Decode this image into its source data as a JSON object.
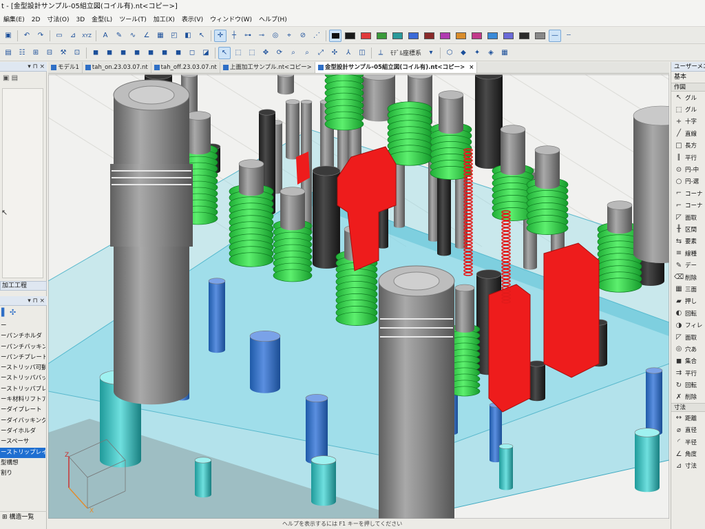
{
  "window": {
    "title": "t - [金型設計サンプル-05組立図(コイル有).nt<コピー>]"
  },
  "menu": [
    "編集(E)",
    "2D",
    "寸法(O)",
    "3D",
    "金型(L)",
    "ツール(T)",
    "加工(X)",
    "表示(V)",
    "ウィンドウ(W)",
    "ヘルプ(H)"
  ],
  "toolbar": {
    "coord_system_label": "ﾓﾃﾞﾙ座標系",
    "xyz_label": "XYZ",
    "colors": [
      "#1a1a1a",
      "#e03a3a",
      "#3a9a3a",
      "#2a9a9a",
      "#3a6ad8",
      "#8a2a2a",
      "#b03ab0",
      "#d98c2a",
      "#c23a8a",
      "#3a8ad8",
      "#6a6ad8",
      "#2a2a2a",
      "#888888"
    ]
  },
  "left_panel": {
    "section_label": "加工工程",
    "tree_items": [
      "ー",
      "ーパンチホルダ",
      "ーパンチバッキング",
      "ーパンチプレート",
      "ーストリッパ可動量",
      "ーストリッパバッキン",
      "ーストリッパプレート",
      "ーキ材料リフトアップ量",
      "ーダイプレート",
      "ーダイバッキング",
      "ーダイホルダ",
      "ースペーサ",
      "ーストリップレイアウト",
      "型構想",
      "割り"
    ],
    "selected_index": 12,
    "status_label": "構造一覧"
  },
  "tabs": [
    {
      "label": "モデル1",
      "active": false
    },
    {
      "label": "tah_on.23.03.07.nt",
      "active": false
    },
    {
      "label": "tah_off.23.03.07.nt",
      "active": false
    },
    {
      "label": "上面加工サンプル.nt<コピー>",
      "active": false
    },
    {
      "label": "金型設計サンプル-05組立図(コイル有).nt<コピー>",
      "active": true
    }
  ],
  "tab_close": "×",
  "viewport": {
    "axis_z": "Z",
    "axis_x": "X",
    "colors": {
      "plate": "#7fd6e8",
      "spring": "#2fd24a",
      "part_red": "#ee1c1c",
      "pin": "#8a8a8a",
      "bolt": "#2b2b2b"
    }
  },
  "status_bar": "ヘルプを表示するには F1 キーを押してください",
  "right_panel": {
    "title": "ユーザーメニュー",
    "subtitle": "基本",
    "section_create": "作図",
    "create_items": [
      {
        "label": "グル",
        "icon": "arrow-icon"
      },
      {
        "label": "グル",
        "icon": "group-icon"
      },
      {
        "label": "十字",
        "icon": "cross-icon"
      },
      {
        "label": "直線",
        "icon": "line-icon"
      },
      {
        "label": "長方",
        "icon": "rect-icon"
      },
      {
        "label": "平行",
        "icon": "parallel-icon"
      },
      {
        "label": "円-中",
        "icon": "circle-center-icon"
      },
      {
        "label": "円-選",
        "icon": "circle-icon"
      },
      {
        "label": "コーナ",
        "icon": "corner-icon"
      },
      {
        "label": "コーナ",
        "icon": "corner-icon"
      },
      {
        "label": "面取",
        "icon": "chamfer-icon"
      },
      {
        "label": "区間",
        "icon": "section-icon"
      },
      {
        "label": "要素",
        "icon": "element-icon"
      },
      {
        "label": "線種",
        "icon": "linetype-icon"
      },
      {
        "label": "デー",
        "icon": "data-icon"
      },
      {
        "label": "削除",
        "icon": "eraser-icon"
      },
      {
        "label": "三面",
        "icon": "three-view-icon"
      },
      {
        "label": "押し",
        "icon": "extrude-icon"
      },
      {
        "label": "回転",
        "icon": "revolve-icon"
      },
      {
        "label": "フィレ",
        "icon": "fillet-icon"
      },
      {
        "label": "面取",
        "icon": "chamfer-icon"
      },
      {
        "label": "穴あ",
        "icon": "hole-icon"
      },
      {
        "label": "集合",
        "icon": "union-icon"
      },
      {
        "label": "平行",
        "icon": "move-icon"
      },
      {
        "label": "回転",
        "icon": "rotate-icon"
      },
      {
        "label": "削除",
        "icon": "delete-icon"
      }
    ],
    "section_dim": "寸法",
    "dim_items": [
      {
        "label": "距離",
        "icon": "distance-icon"
      },
      {
        "label": "直径",
        "icon": "diameter-icon"
      },
      {
        "label": "半径",
        "icon": "radius-icon"
      },
      {
        "label": "角度",
        "icon": "angle-icon"
      },
      {
        "label": "寸法",
        "icon": "dim-icon"
      }
    ]
  }
}
